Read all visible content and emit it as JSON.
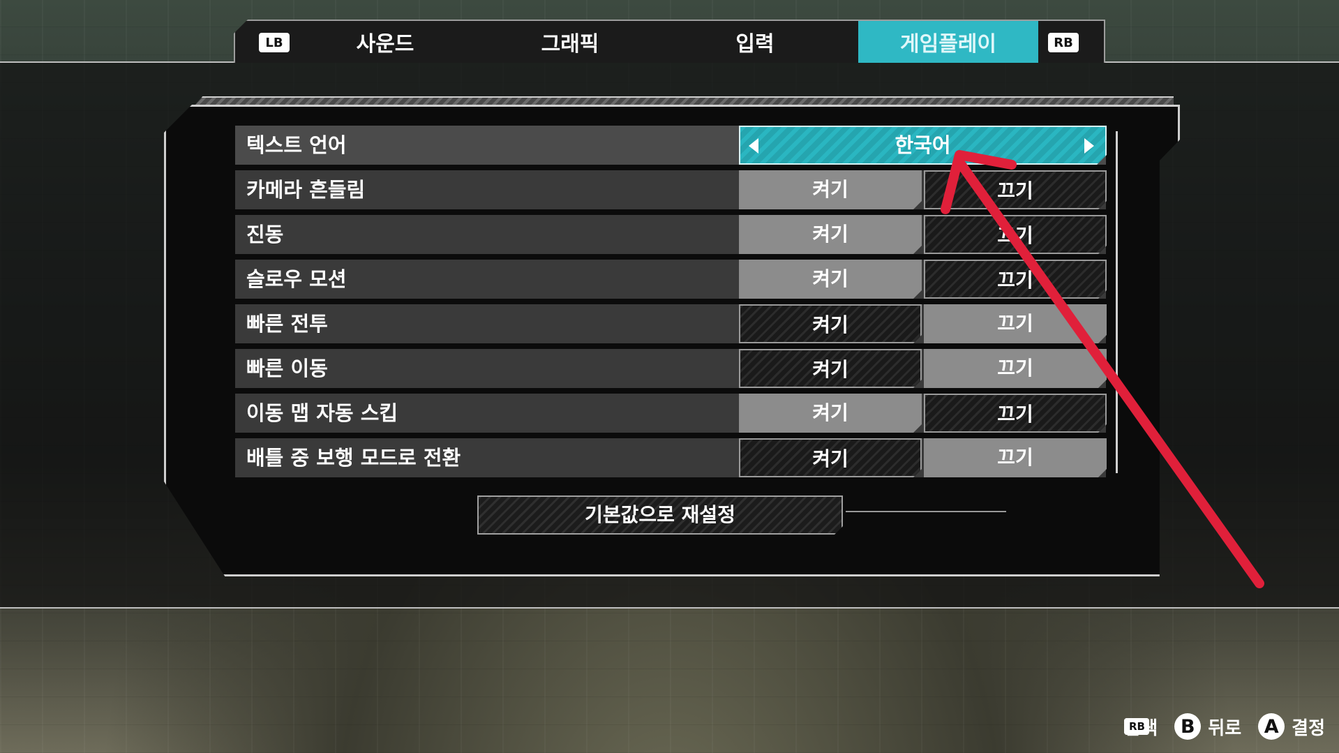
{
  "tabs": {
    "lb": "LB",
    "rb": "RB",
    "items": [
      {
        "label": "사운드"
      },
      {
        "label": "그래픽"
      },
      {
        "label": "입력"
      },
      {
        "label": "게임플레이"
      }
    ],
    "active": "게임플레이"
  },
  "settings": {
    "language": {
      "label": "텍스트 언어",
      "value": "한국어"
    },
    "rows": [
      {
        "label": "카메라 흔들림",
        "on": "켜기",
        "off": "끄기",
        "selected": "on"
      },
      {
        "label": "진동",
        "on": "켜기",
        "off": "끄기",
        "selected": "on"
      },
      {
        "label": "슬로우 모션",
        "on": "켜기",
        "off": "끄기",
        "selected": "on"
      },
      {
        "label": "빠른 전투",
        "on": "켜기",
        "off": "끄기",
        "selected": "off"
      },
      {
        "label": "빠른 이동",
        "on": "켜기",
        "off": "끄기",
        "selected": "off"
      },
      {
        "label": "이동 맵 자동 스킵",
        "on": "켜기",
        "off": "끄기",
        "selected": "on"
      },
      {
        "label": "배틀 중 보행 모드로 전환",
        "on": "켜기",
        "off": "끄기",
        "selected": "off"
      }
    ]
  },
  "reset_label": "기본값으로 재설정",
  "footer": {
    "lb": "LB",
    "rb": "RB",
    "navigate": "탐색",
    "b_btn": "B",
    "back": "뒤로",
    "a_btn": "A",
    "confirm": "결정"
  },
  "colors": {
    "accent": "#2fb8c4",
    "annotation": "#e0203a"
  }
}
